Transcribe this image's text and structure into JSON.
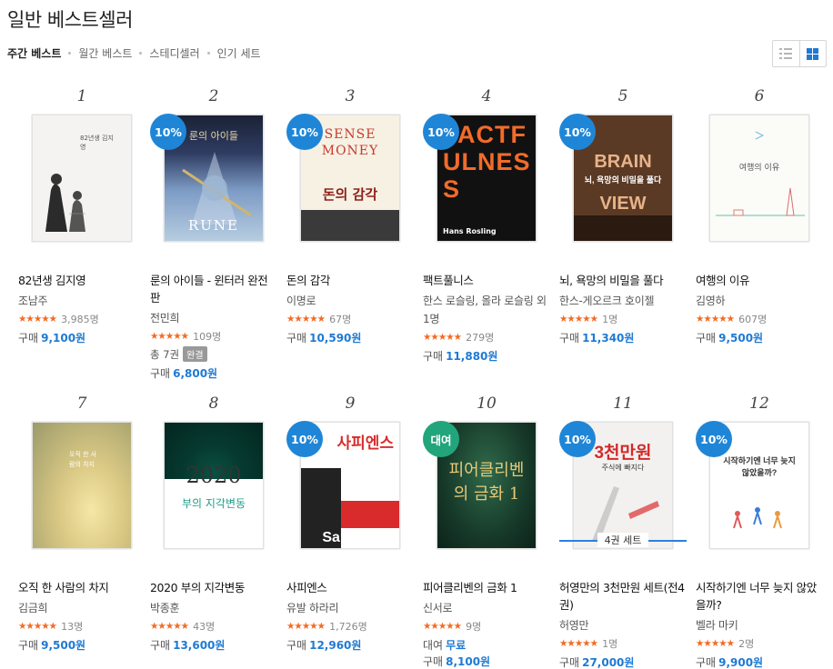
{
  "page": {
    "title": "일반 베스트셀러"
  },
  "tabs": [
    {
      "label": "주간 베스트",
      "active": true
    },
    {
      "label": "월간 베스트",
      "active": false
    },
    {
      "label": "스테디셀러",
      "active": false
    },
    {
      "label": "인기 세트",
      "active": false
    }
  ],
  "view_toggle": {
    "list_icon": "list-view-icon",
    "grid_icon": "grid-view-icon",
    "active": "grid",
    "accent": "#1e7ad3"
  },
  "books": [
    {
      "rank": "1",
      "title": "82년생 김지영",
      "author": "조남주",
      "rating_count": "3,985명",
      "purchase_label": "구매",
      "price": "9,100원",
      "cover_text": "82년생 김지영"
    },
    {
      "rank": "2",
      "badge": "10%",
      "title": "룬의 아이들 - 윈터러 완전판",
      "author": "전민희",
      "rating_count": "109명",
      "volumes": "총 7권",
      "status_tag": "완결",
      "purchase_label": "구매",
      "price": "6,800원",
      "cover_text": "룬의 아이들",
      "cover_sub": "RUNE"
    },
    {
      "rank": "3",
      "badge": "10%",
      "title": "돈의 감각",
      "author": "이명로",
      "rating_count": "67명",
      "purchase_label": "구매",
      "price": "10,590원",
      "cover_text": "돈의 감각",
      "cover_sub": "SENSE MONEY"
    },
    {
      "rank": "4",
      "badge": "10%",
      "title": "팩트풀니스",
      "author": "한스 로슬링, 올라 로슬링 외 1명",
      "rating_count": "279명",
      "purchase_label": "구매",
      "price": "11,880원",
      "cover_text": "FACTFULNESS",
      "cover_sub": "Hans Rosling"
    },
    {
      "rank": "5",
      "badge": "10%",
      "title": "뇌, 욕망의 비밀을 풀다",
      "author": "한스-게오르크 호이젤",
      "rating_count": "1명",
      "purchase_label": "구매",
      "price": "11,340원",
      "cover_text": "BRAIN VIEW",
      "cover_sub": "뇌, 욕망의 비밀을 풀다"
    },
    {
      "rank": "6",
      "title": "여행의 이유",
      "author": "김영하",
      "rating_count": "607명",
      "purchase_label": "구매",
      "price": "9,500원",
      "cover_text": "여행의 이유"
    },
    {
      "rank": "7",
      "title": "오직 한 사람의 차지",
      "author": "김금희",
      "rating_count": "13명",
      "purchase_label": "구매",
      "price": "9,500원",
      "cover_text": "오직 한 사람의 차지"
    },
    {
      "rank": "8",
      "title": "2020 부의 지각변동",
      "author": "박종훈",
      "rating_count": "43명",
      "purchase_label": "구매",
      "price": "13,600원",
      "cover_text": "2020",
      "cover_sub": "부의 지각변동"
    },
    {
      "rank": "9",
      "badge": "10%",
      "title": "사피엔스",
      "author": "유발 하라리",
      "rating_count": "1,726명",
      "purchase_label": "구매",
      "price": "12,960원",
      "cover_text": "사피엔스",
      "cover_sub": "Sapiens"
    },
    {
      "rank": "10",
      "badge_rent": "대여",
      "title": "피어클리벤의 금화 1",
      "author": "신서로",
      "rating_count": "9명",
      "rent_label": "대여",
      "rent_price": "무료",
      "purchase_label": "구매",
      "price": "8,100원",
      "cover_text": "피어클리벤의 금화 1"
    },
    {
      "rank": "11",
      "badge": "10%",
      "set_label": "4권 세트",
      "title": "허영만의 3천만원 세트(전4권)",
      "author": "허영만",
      "rating_count": "1명",
      "purchase_label": "구매",
      "price": "27,000원",
      "cover_text": "3천만원",
      "cover_sub": "주식에 빠지다"
    },
    {
      "rank": "12",
      "badge": "10%",
      "title": "시작하기엔 너무 늦지 않았을까?",
      "author": "벨라 마키",
      "rating_count": "2명",
      "purchase_label": "구매",
      "price": "9,900원",
      "cover_text": "시작하기엔 너무 늦지 않았을까?"
    }
  ]
}
